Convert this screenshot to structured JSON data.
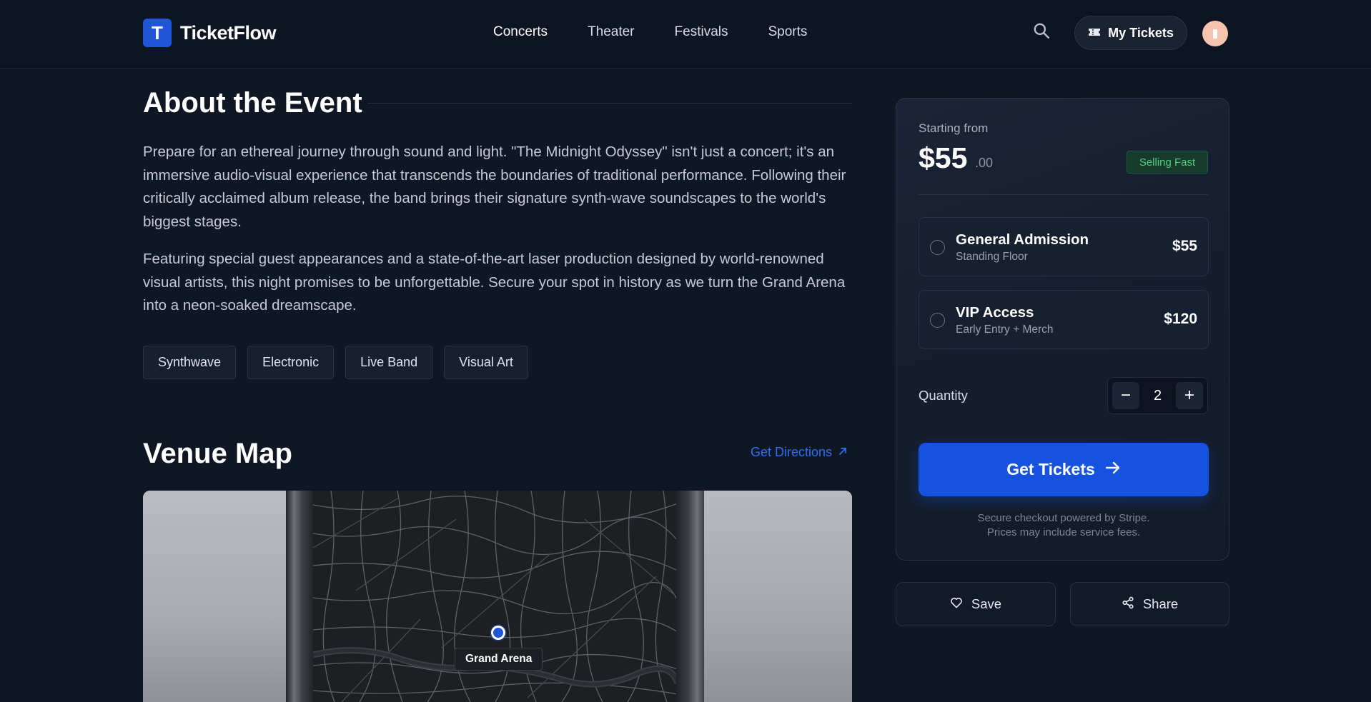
{
  "header": {
    "logo_letter": "T",
    "logo_text": "TicketFlow",
    "nav": [
      "Concerts",
      "Theater",
      "Festivals",
      "Sports"
    ],
    "active_nav": "Concerts",
    "my_tickets_label": "My Tickets"
  },
  "about": {
    "title": "About the Event",
    "paragraph1": "Prepare for an ethereal journey through sound and light. \"The Midnight Odyssey\" isn't just a concert; it's an immersive audio-visual experience that transcends the boundaries of traditional performance. Following their critically acclaimed album release, the band brings their signature synth-wave soundscapes to the world's biggest stages.",
    "paragraph2": "Featuring special guest appearances and a state-of-the-art laser production designed by world-renowned visual artists, this night promises to be unforgettable. Secure your spot in history as we turn the Grand Arena into a neon-soaked dreamscape.",
    "tags": [
      "Synthwave",
      "Electronic",
      "Live Band",
      "Visual Art"
    ]
  },
  "venue": {
    "title": "Venue Map",
    "directions_label": "Get Directions",
    "pin_label": "Grand Arena"
  },
  "ticket_card": {
    "starting_label": "Starting from",
    "price_main": "$55",
    "price_cents": ".00",
    "badge": "Selling Fast",
    "options": [
      {
        "name": "General Admission",
        "sub": "Standing Floor",
        "price": "$55"
      },
      {
        "name": "VIP Access",
        "sub": "Early Entry + Merch",
        "price": "$120"
      }
    ],
    "quantity_label": "Quantity",
    "quantity_value": "2",
    "minus": "−",
    "plus": "+",
    "cta_label": "Get Tickets",
    "fine_line1": "Secure checkout powered by Stripe.",
    "fine_line2": "Prices may include service fees."
  },
  "actions": {
    "save_label": "Save",
    "share_label": "Share"
  },
  "colors": {
    "accent": "#1553de",
    "success": "#4ad17d",
    "background": "#0f1624"
  }
}
